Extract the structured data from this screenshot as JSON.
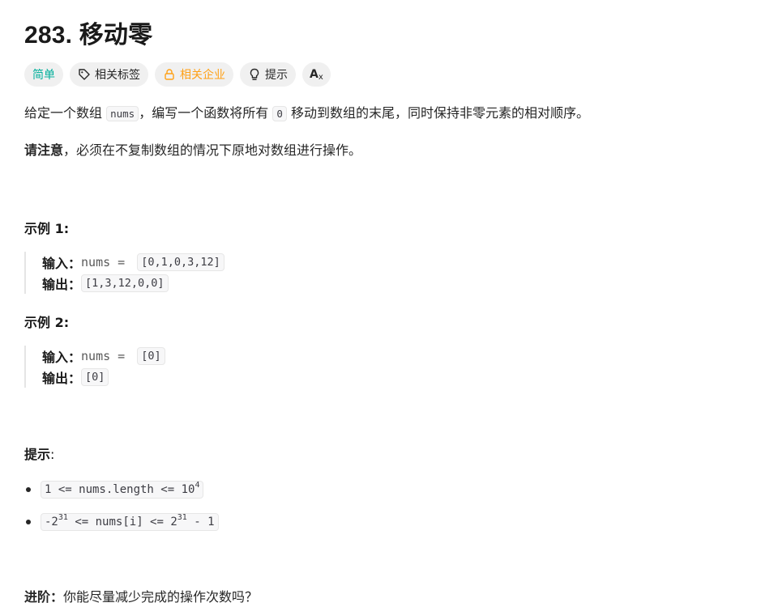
{
  "title": "283. 移动零",
  "tags": {
    "difficulty": "简单",
    "topics": "相关标签",
    "companies": "相关企业",
    "hint": "提示",
    "translate": "A"
  },
  "description": {
    "p1_before": "给定一个数组",
    "p1_code": "nums",
    "p1_mid": "，编写一个函数将所有",
    "p1_code2": "0",
    "p1_after": "移动到数组的末尾，同时保持非零元素的相对顺序。",
    "note_bold": "请注意",
    "note_rest": "，必须在不复制数组的情况下原地对数组进行操作。"
  },
  "examples": [
    {
      "heading": "示例 1:",
      "input_label": "输入：",
      "input_var": "nums = ",
      "input_value": "[0,1,0,3,12]",
      "output_label": "输出：",
      "output_value": "[1,3,12,0,0]"
    },
    {
      "heading": "示例 2:",
      "input_label": "输入：",
      "input_var": "nums = ",
      "input_value": "[0]",
      "output_label": "输出：",
      "output_value": "[0]"
    }
  ],
  "constraints": {
    "heading": "提示",
    "colon": ":",
    "c1_text": "1 <= nums.length <= 10",
    "c1_sup": "4",
    "c2_pre": "-2",
    "c2_sup1": "31",
    "c2_mid": " <= nums[i] <= 2",
    "c2_sup2": "31",
    "c2_post": " - 1"
  },
  "followup": {
    "bold": "进阶：",
    "text": "你能尽量减少完成的操作次数吗？"
  },
  "colors": {
    "easy": "#00af9b",
    "company": "#ffa116",
    "tag_bg": "#f0f0f0"
  }
}
